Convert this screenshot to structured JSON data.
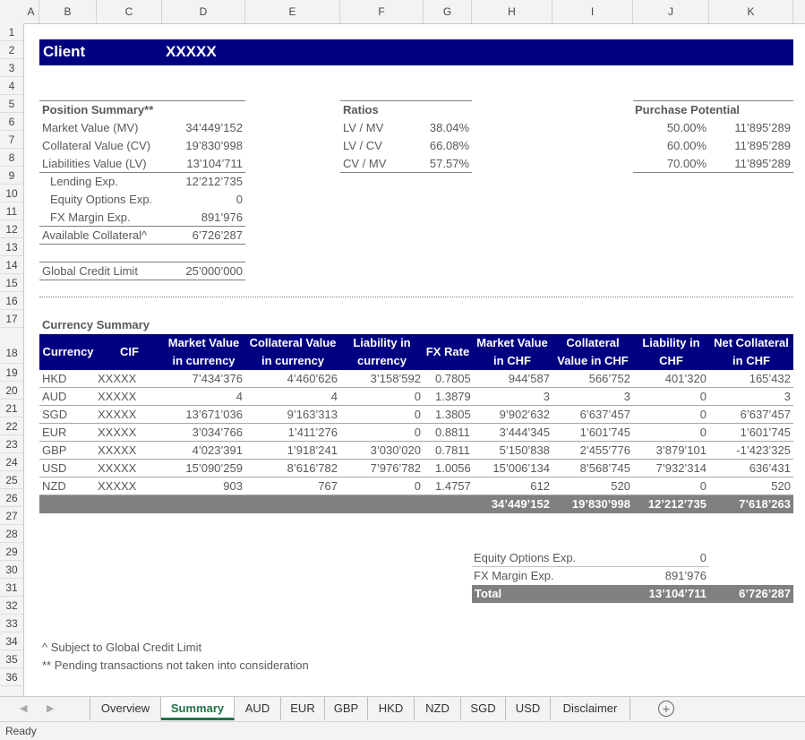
{
  "columns": [
    "A",
    "B",
    "C",
    "D",
    "E",
    "F",
    "G",
    "H",
    "I",
    "J",
    "K"
  ],
  "rows": [
    "1",
    "2",
    "3",
    "4",
    "5",
    "6",
    "7",
    "8",
    "9",
    "10",
    "11",
    "12",
    "13",
    "14",
    "15",
    "16",
    "17",
    "18",
    "19",
    "20",
    "21",
    "22",
    "23",
    "24",
    "25",
    "26",
    "27",
    "28",
    "29",
    "30",
    "31",
    "32",
    "33",
    "34",
    "35",
    "36"
  ],
  "client": {
    "label": "Client",
    "value": "XXXXX"
  },
  "position_summary": {
    "title": "Position Summary**",
    "items": [
      {
        "label": "Market Value (MV)",
        "value": "34’449’152"
      },
      {
        "label": "Collateral Value (CV)",
        "value": "19’830’998"
      },
      {
        "label": "Liabilities Value (LV)",
        "value": "13’104’711"
      },
      {
        "label": "Lending Exp.",
        "value": "12’212’735"
      },
      {
        "label": "Equity Options Exp.",
        "value": "0"
      },
      {
        "label": "FX Margin Exp.",
        "value": "891’976"
      },
      {
        "label": "Available Collateral^",
        "value": "6’726’287"
      }
    ],
    "credit_limit_label": "Global Credit Limit",
    "credit_limit_value": "25’000’000"
  },
  "ratios": {
    "title": "Ratios",
    "items": [
      {
        "label": "LV / MV",
        "value": "38.04%"
      },
      {
        "label": "LV / CV",
        "value": "66.08%"
      },
      {
        "label": "CV / MV",
        "value": "57.57%"
      }
    ]
  },
  "purchase_potential": {
    "title": "Purchase Potential",
    "items": [
      {
        "pct": "50.00%",
        "value": "11’895’289"
      },
      {
        "pct": "60.00%",
        "value": "11’895’289"
      },
      {
        "pct": "70.00%",
        "value": "11’895’289"
      }
    ]
  },
  "currency_summary": {
    "title": "Currency Summary",
    "headers": [
      {
        "l1": "Currency",
        "l2": ""
      },
      {
        "l1": "CIF",
        "l2": ""
      },
      {
        "l1": "Market Value",
        "l2": "in currency"
      },
      {
        "l1": "Collateral Value",
        "l2": "in currency"
      },
      {
        "l1": "Liability in",
        "l2": "currency"
      },
      {
        "l1": "FX Rate",
        "l2": ""
      },
      {
        "l1": "Market Value",
        "l2": "in CHF"
      },
      {
        "l1": "Collateral",
        "l2": "Value in CHF"
      },
      {
        "l1": "Liability in",
        "l2": "CHF"
      },
      {
        "l1": "Net Collateral",
        "l2": "in CHF"
      }
    ],
    "rows": [
      [
        "HKD",
        "XXXXX",
        "7’434’376",
        "4’460’626",
        "3’158’592",
        "0.7805",
        "944’587",
        "566’752",
        "401’320",
        "165’432"
      ],
      [
        "AUD",
        "XXXXX",
        "4",
        "4",
        "0",
        "1.3879",
        "3",
        "3",
        "0",
        "3"
      ],
      [
        "SGD",
        "XXXXX",
        "13’671’036",
        "9’163’313",
        "0",
        "1.3805",
        "9’902’632",
        "6’637’457",
        "0",
        "6’637’457"
      ],
      [
        "EUR",
        "XXXXX",
        "3’034’766",
        "1’411’276",
        "0",
        "0.8811",
        "3’444’345",
        "1’601’745",
        "0",
        "1’601’745"
      ],
      [
        "GBP",
        "XXXXX",
        "4’023’391",
        "1’918’241",
        "3’030’020",
        "0.7811",
        "5’150’838",
        "2’455’776",
        "3’879’101",
        "-1’423’325"
      ],
      [
        "USD",
        "XXXXX",
        "15’090’259",
        "8’616’782",
        "7’976’782",
        "1.0056",
        "15’006’134",
        "8’568’745",
        "7’932’314",
        "636’431"
      ],
      [
        "NZD",
        "XXXXX",
        "903",
        "767",
        "0",
        "1.4757",
        "612",
        "520",
        "0",
        "520"
      ]
    ],
    "totals": [
      "34’449’152",
      "19’830’998",
      "12’212’735",
      "7’618’263"
    ]
  },
  "bottom_summary": {
    "items": [
      {
        "label": "Equity Options Exp.",
        "value": "0"
      },
      {
        "label": "FX Margin Exp.",
        "value": "891’976"
      }
    ],
    "total_label": "Total",
    "total_liability": "13’104’711",
    "total_net": "6’726’287"
  },
  "footnotes": [
    "^ Subject to Global Credit Limit",
    "** Pending transactions not taken into consideration"
  ],
  "sheet_tabs": [
    "Overview",
    "Summary",
    "AUD",
    "EUR",
    "GBP",
    "HKD",
    "NZD",
    "SGD",
    "USD",
    "Disclaimer"
  ],
  "active_tab": "Summary",
  "status": "Ready",
  "colors": {
    "header_blue": "#000080",
    "total_grey": "#808080",
    "active_tab_green": "#217346"
  }
}
